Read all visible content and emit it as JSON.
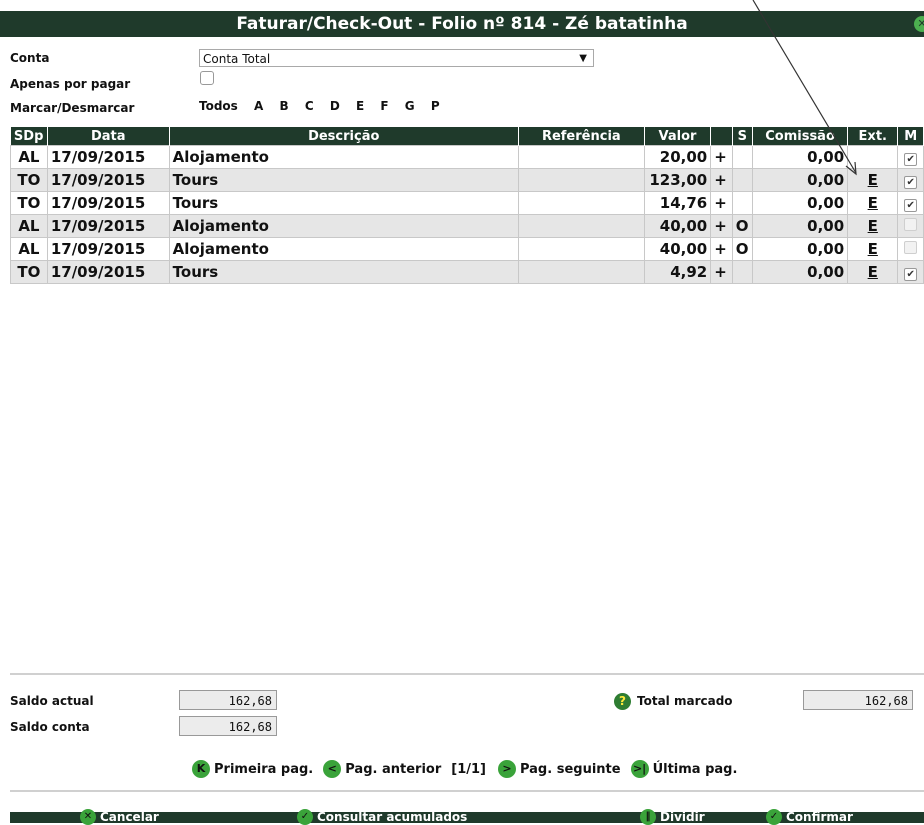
{
  "window": {
    "title": "Faturar/Check-Out - Folio nº 814 - Zé batatinha"
  },
  "form": {
    "conta_label": "Conta",
    "conta_value": "Conta Total",
    "apenas_label": "Apenas por pagar",
    "marcar_label": "Marcar/Desmarcar",
    "marcar_options": [
      "Todos",
      "A",
      "B",
      "C",
      "D",
      "E",
      "F",
      "G",
      "P"
    ]
  },
  "table": {
    "headers": [
      "SDp",
      "Data",
      "Descrição",
      "Referência",
      "Valor",
      "",
      "S",
      "Comissão",
      "Ext.",
      "M"
    ],
    "rows": [
      {
        "sdp": "AL",
        "data": "17/09/2015",
        "desc": "Alojamento",
        "ref": "",
        "valor": "20,00",
        "sign": "+",
        "s": "",
        "comissao": "0,00",
        "ext": "",
        "checked": true
      },
      {
        "sdp": "TO",
        "data": "17/09/2015",
        "desc": "Tours",
        "ref": "",
        "valor": "123,00",
        "sign": "+",
        "s": "",
        "comissao": "0,00",
        "ext": "E",
        "checked": true
      },
      {
        "sdp": "TO",
        "data": "17/09/2015",
        "desc": "Tours",
        "ref": "",
        "valor": "14,76",
        "sign": "+",
        "s": "",
        "comissao": "0,00",
        "ext": "E",
        "checked": true
      },
      {
        "sdp": "AL",
        "data": "17/09/2015",
        "desc": "Alojamento",
        "ref": "",
        "valor": "40,00",
        "sign": "+",
        "s": "O",
        "comissao": "0,00",
        "ext": "E",
        "checked": false
      },
      {
        "sdp": "AL",
        "data": "17/09/2015",
        "desc": "Alojamento",
        "ref": "",
        "valor": "40,00",
        "sign": "+",
        "s": "O",
        "comissao": "0,00",
        "ext": "E",
        "checked": false
      },
      {
        "sdp": "TO",
        "data": "17/09/2015",
        "desc": "Tours",
        "ref": "",
        "valor": "4,92",
        "sign": "+",
        "s": "",
        "comissao": "0,00",
        "ext": "E",
        "checked": true
      }
    ]
  },
  "summary": {
    "saldo_actual_label": "Saldo actual",
    "saldo_actual_value": "162,68",
    "saldo_conta_label": "Saldo conta",
    "saldo_conta_value": "162,68",
    "total_marcado_label": "Total marcado",
    "total_marcado_value": "162,68"
  },
  "pager": {
    "first": "Primeira pag.",
    "prev": "Pag. anterior",
    "info": "[1/1]",
    "next": "Pag. seguinte",
    "last": "Última pag."
  },
  "footer": {
    "cancel": "Cancelar",
    "consultar": "Consultar acumulados",
    "dividir": "Dividir",
    "confirmar": "Confirmar"
  }
}
